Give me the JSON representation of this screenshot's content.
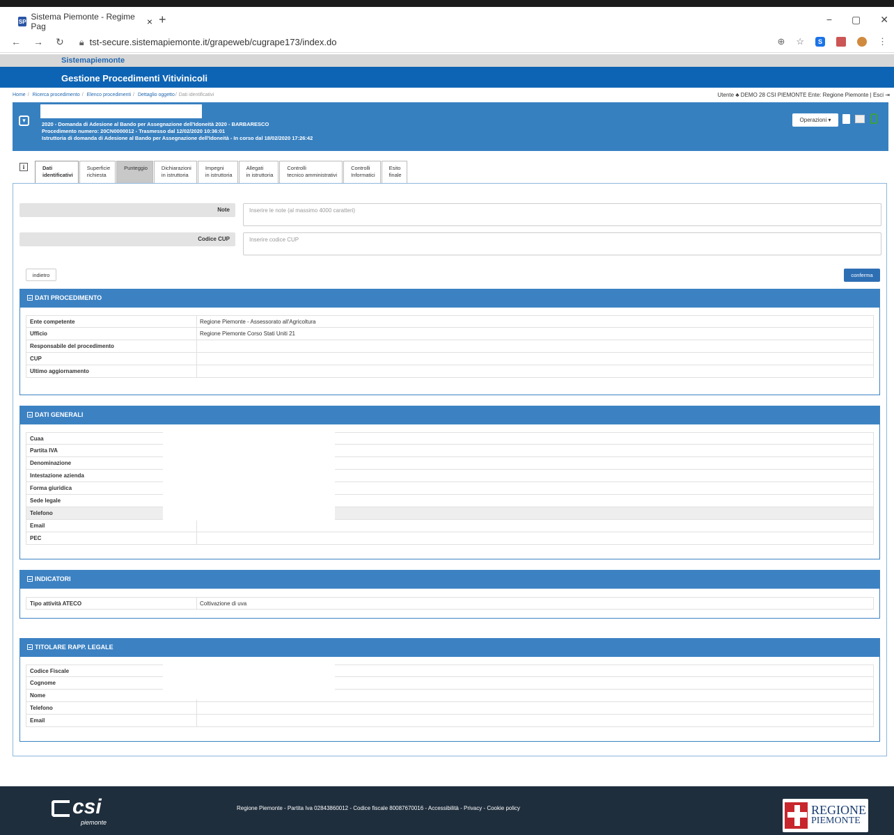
{
  "browser": {
    "tab_title": "Sistema Piemonte - Regime Pag",
    "tab_close": "×",
    "new_tab": "+",
    "favicon": "SP",
    "url": "tst-secure.sistemapiemonte.it/grapeweb/cugrape173/index.do",
    "win_min": "−",
    "win_max": "▢",
    "win_close": "✕"
  },
  "app": {
    "brand": "Sistemapiemonte",
    "title": "Gestione Procedimenti Vitivinicoli"
  },
  "breadcrumb": [
    "Home",
    "Ricerca procedimento",
    "Elenco procedimenti",
    "Dettaglio oggetto",
    "Dati identificativi"
  ],
  "user": {
    "text": "Utente ♣ DEMO 28 CSI PIEMONTE   Ente: Regione Piemonte | Esci ⇥"
  },
  "procedure": {
    "line1": "2020 - Domanda di Adesione al Bando per Assegnazione dell'Idoneità 2020 - BARBARESCO",
    "line2": "Procedimento numero: 20CN0000012 - Trasmesso dal 12/02/2020 10:36:01",
    "line3": "Istruttoria di domanda di Adesione al Bando per Assegnazione dell'Idoneità - In corso dal 18/02/2020 17:26:42",
    "operations_label": "Operazioni ▾"
  },
  "tabs": [
    {
      "l1": "Dati",
      "l2": "identificativi"
    },
    {
      "l1": "Superficie",
      "l2": "richiesta"
    },
    {
      "l1": "Punteggio",
      "l2": ""
    },
    {
      "l1": "Dichiarazioni",
      "l2": "in istruttoria"
    },
    {
      "l1": "Impegni",
      "l2": "in istruttoria"
    },
    {
      "l1": "Allegati",
      "l2": "in istruttoria"
    },
    {
      "l1": "Controlli",
      "l2": "tecnico amministrativi"
    },
    {
      "l1": "Controlli",
      "l2": "Informatici"
    },
    {
      "l1": "Esito",
      "l2": "finale"
    }
  ],
  "form": {
    "note_label": "Note",
    "note_placeholder": "Inserire le note (al massimo 4000 caratteri)",
    "cup_label": "Codice CUP",
    "cup_placeholder": "Inserire codice CUP",
    "back_label": "indietro",
    "confirm_label": "conferma"
  },
  "sections": {
    "procedimento": {
      "title": "DATI PROCEDIMENTO",
      "rows": [
        {
          "k": "Ente competente",
          "v": "Regione Piemonte - Assessorato all'Agricoltura"
        },
        {
          "k": "Ufficio",
          "v": "Regione Piemonte Corso Stati Uniti 21"
        },
        {
          "k": "Responsabile del procedimento",
          "v": ""
        },
        {
          "k": "CUP",
          "v": ""
        },
        {
          "k": "Ultimo aggiornamento",
          "v": ""
        }
      ]
    },
    "generali": {
      "title": "DATI GENERALI",
      "rows": [
        {
          "k": "Cuaa",
          "v": ""
        },
        {
          "k": "Partita IVA",
          "v": ""
        },
        {
          "k": "Denominazione",
          "v": ""
        },
        {
          "k": "Intestazione azienda",
          "v": ""
        },
        {
          "k": "Forma giuridica",
          "v": ""
        },
        {
          "k": "Sede legale",
          "v": ""
        },
        {
          "k": "Telefono",
          "v": ""
        },
        {
          "k": "Email",
          "v": ""
        },
        {
          "k": "PEC",
          "v": ""
        }
      ]
    },
    "indicatori": {
      "title": "INDICATORI",
      "rows": [
        {
          "k": "Tipo attività ATECO",
          "v": "Coltivazione di uva"
        }
      ]
    },
    "titolare": {
      "title": "TITOLARE RAPP. LEGALE",
      "rows": [
        {
          "k": "Codice Fiscale",
          "v": ""
        },
        {
          "k": "Cognome",
          "v": ""
        },
        {
          "k": "Nome",
          "v": ""
        },
        {
          "k": "Telefono",
          "v": ""
        },
        {
          "k": "Email",
          "v": ""
        }
      ]
    }
  },
  "footer": {
    "text": "Regione Piemonte - Partita Iva 02843860012 - Codice fiscale 80087670016 - Accessibilità - Privacy - Cookie policy",
    "csi_logo": "csi",
    "csi_sub": "piemonte",
    "rp_line1": "REGIONE",
    "rp_line2": "PIEMONTE"
  },
  "colors": {
    "header_blue": "#0e64b4",
    "section_blue": "#3c82c3",
    "footer_dark": "#1f2e3d"
  }
}
